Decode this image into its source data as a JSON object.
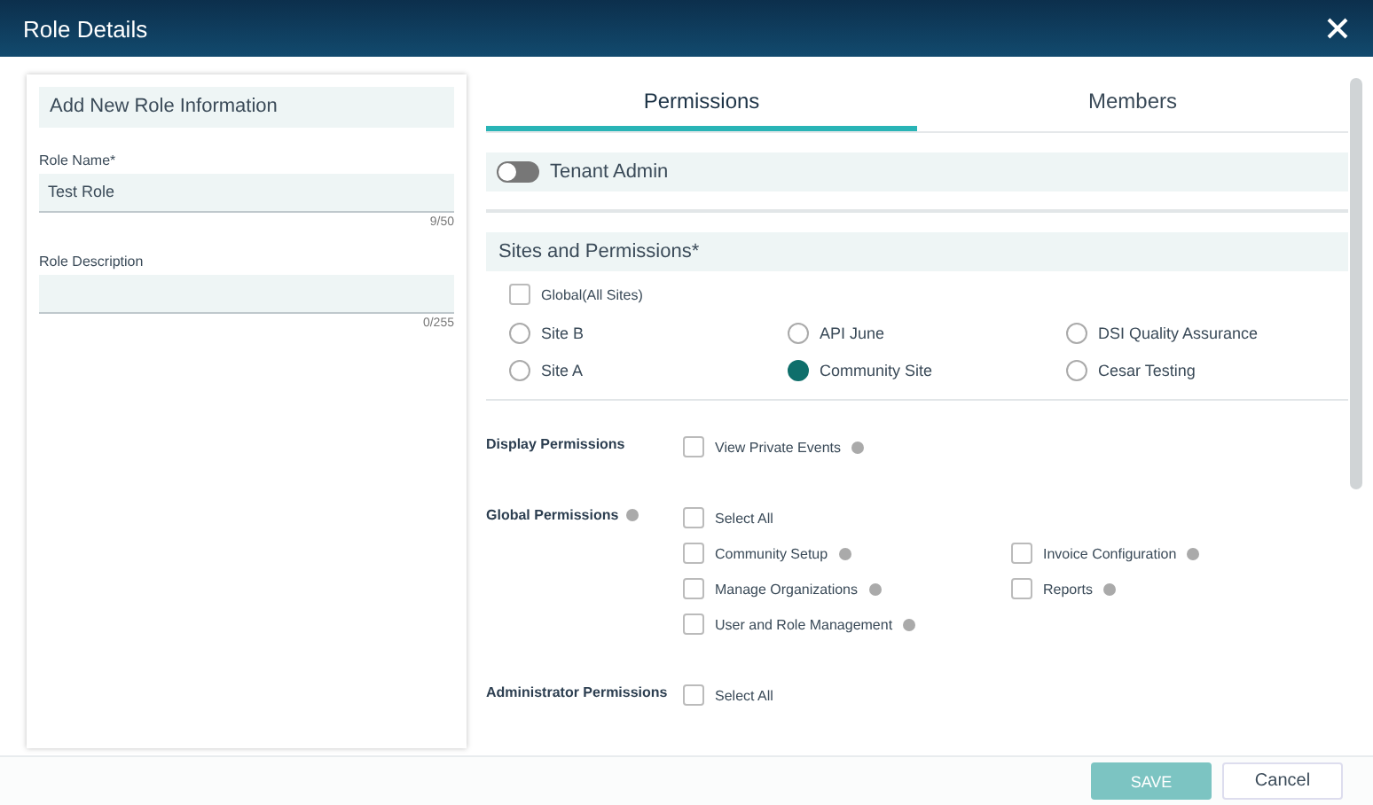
{
  "window": {
    "title": "Role Details"
  },
  "role_form": {
    "title": "Add New Role Information",
    "fields": [
      {
        "label": "Role Name*",
        "value": "Test Role",
        "counter": "9/50"
      },
      {
        "label": "Role Description",
        "counter": "0/255"
      }
    ]
  },
  "tabs": [
    {
      "label": "Permissions",
      "selected": true
    },
    {
      "label": "Members",
      "selected": false
    }
  ],
  "tenant_admin": {
    "label": "Tenant Admin",
    "on": false
  },
  "sites": {
    "title": "Sites and Permissions*",
    "global": {
      "label": "Global(All Sites)",
      "checked": false
    },
    "options": [
      {
        "label": "Site B",
        "selected": false
      },
      {
        "label": "API June",
        "selected": false
      },
      {
        "label": "DSI Quality Assurance",
        "selected": false
      },
      {
        "label": "Site A",
        "selected": false
      },
      {
        "label": "Community Site",
        "selected": true
      },
      {
        "label": "Cesar Testing",
        "selected": false
      }
    ]
  },
  "permission_groups": [
    {
      "title": "Display Permissions",
      "help": false,
      "items": [
        {
          "kind": "item",
          "label": "View Private Events",
          "checked": false,
          "help": true
        }
      ]
    },
    {
      "title": "Global Permissions",
      "help": true,
      "items": [
        {
          "kind": "select_all",
          "label": "Select All",
          "checked": false,
          "help": false
        },
        {
          "kind": "item",
          "label": "Community Setup",
          "checked": false,
          "help": true
        },
        {
          "kind": "item",
          "label": "Invoice Configuration",
          "checked": false,
          "help": true
        },
        {
          "kind": "item",
          "label": "Manage Organizations",
          "checked": false,
          "help": true
        },
        {
          "kind": "item",
          "label": "Reports",
          "checked": false,
          "help": true
        },
        {
          "kind": "item",
          "label": "User and Role Management",
          "checked": false,
          "help": true
        }
      ]
    },
    {
      "title": "Administrator Permissions",
      "help": false,
      "items": [
        {
          "kind": "select_all",
          "label": "Select All",
          "checked": false,
          "help": false
        }
      ]
    }
  ],
  "buttons": [
    {
      "kind": "primary",
      "label": "SAVE",
      "disabled": true
    },
    {
      "kind": "secondary",
      "label": "Cancel",
      "disabled": false
    }
  ]
}
